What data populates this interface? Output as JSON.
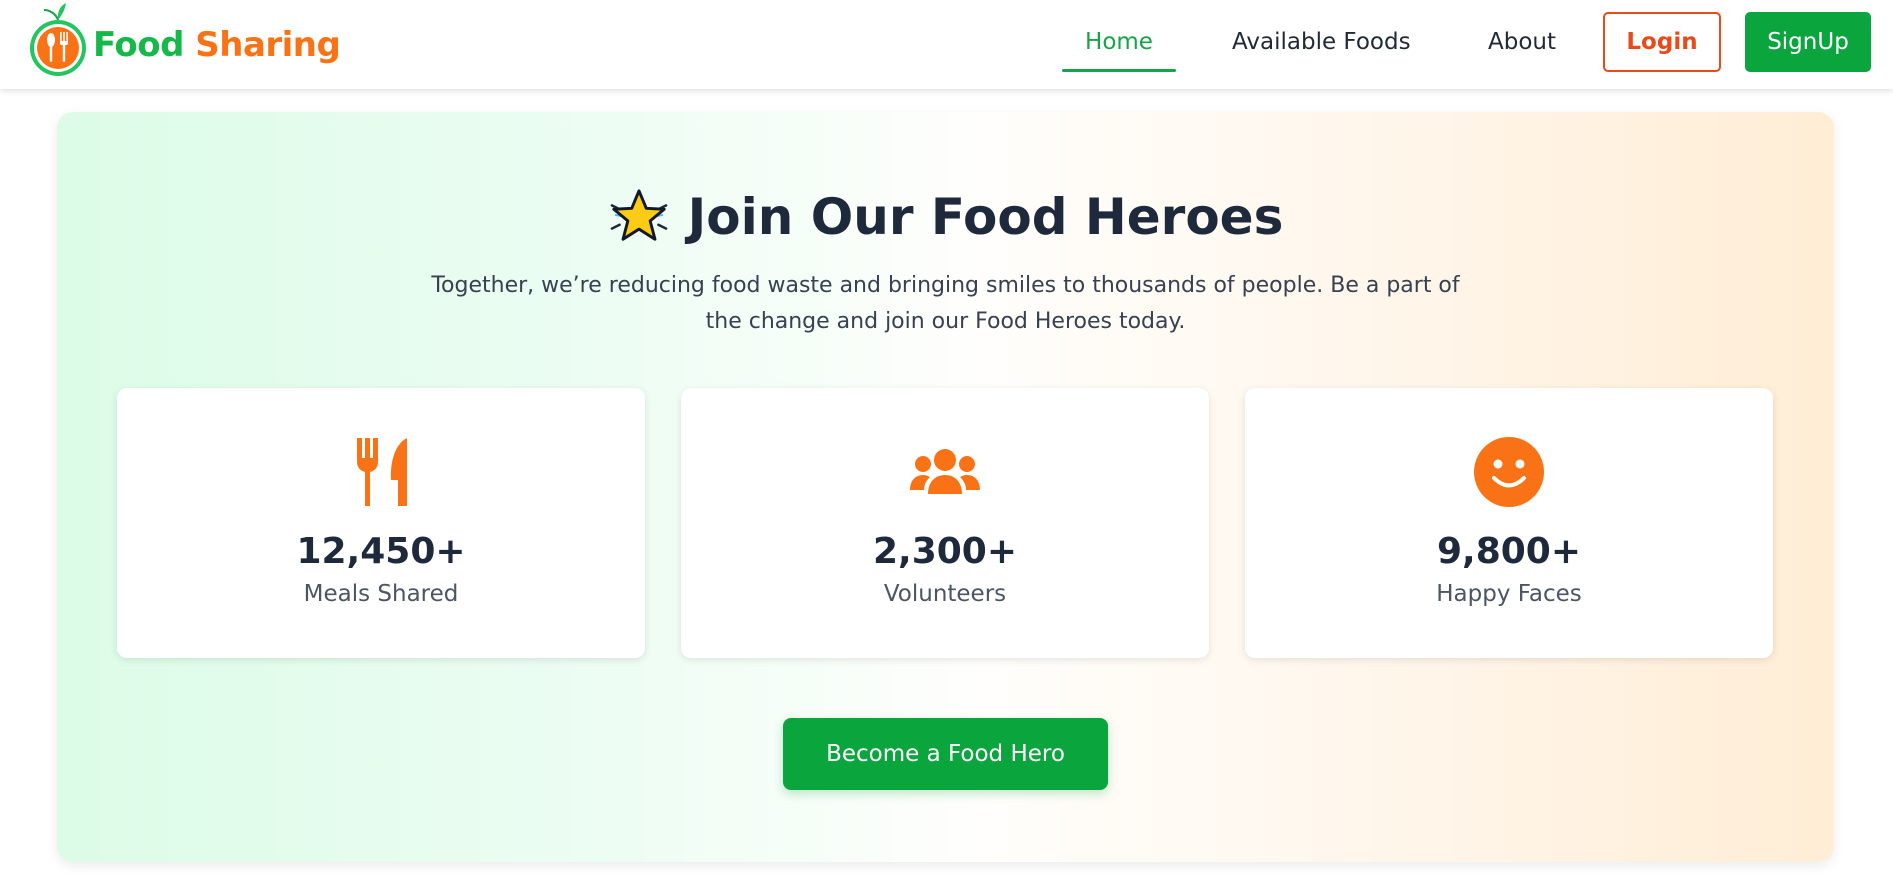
{
  "brand": {
    "name_part1": "Food",
    "name_part2": "Sharing",
    "logo_icon": "fork-spoon-logo-icon"
  },
  "nav": {
    "items": [
      {
        "label": "Home",
        "active": true
      },
      {
        "label": "Available Foods",
        "active": false
      },
      {
        "label": "About",
        "active": false
      }
    ],
    "login_label": "Login",
    "signup_label": "SignUp"
  },
  "hero": {
    "title_icon": "star-icon",
    "title": "Join Our Food Heroes",
    "subtitle_line1": "Together, we’re reducing food waste and bringing smiles to thousands of people. Be a part of",
    "subtitle_line2": "the change and join our Food Heroes today.",
    "stats": [
      {
        "icon": "utensils-icon",
        "value": "12,450+",
        "label": "Meals Shared"
      },
      {
        "icon": "users-icon",
        "value": "2,300+",
        "label": "Volunteers"
      },
      {
        "icon": "smile-icon",
        "value": "9,800+",
        "label": "Happy Faces"
      }
    ],
    "cta_label": "Become a Food Hero"
  },
  "colors": {
    "primary_green": "#0ba53e",
    "active_green": "#16a34a",
    "accent_orange": "#f97316",
    "login_red": "#ea4a1a",
    "text_dark": "#1e293b"
  }
}
